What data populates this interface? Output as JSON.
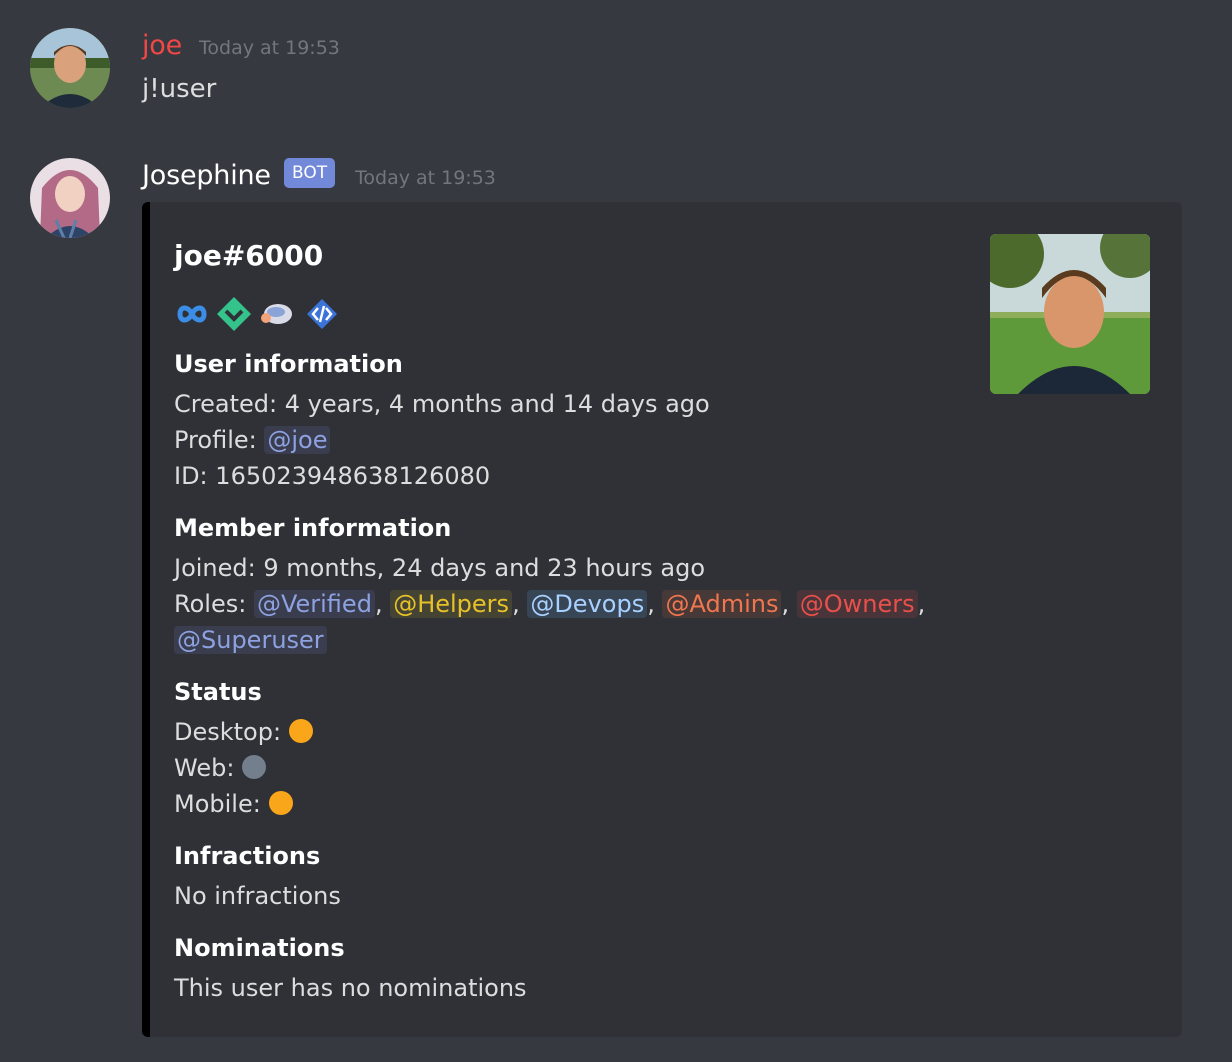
{
  "messages": {
    "first": {
      "author": "joe",
      "author_color": "#f04747",
      "timestamp": "Today at 19:53",
      "text": "j!user"
    },
    "second": {
      "author": "Josephine",
      "author_color": "#ffffff",
      "bot_tag": "BOT",
      "timestamp": "Today at 19:53"
    }
  },
  "embed": {
    "title": "joe#6000",
    "badges": [
      "hypesquad-balance-icon",
      "early-supporter-icon",
      "nitro-icon",
      "developer-badge-icon"
    ],
    "user_info": {
      "heading": "User information",
      "created_label": "Created:",
      "created_value": "4 years, 4 months and 14 days ago",
      "profile_label": "Profile:",
      "profile_mention": "@joe",
      "id_label": "ID:",
      "id_value": "165023948638126080"
    },
    "member_info": {
      "heading": "Member information",
      "joined_label": "Joined:",
      "joined_value": "9 months, 24 days and 23 hours ago",
      "roles_label": "Roles:",
      "roles": [
        "@Verified",
        "@Helpers",
        "@Devops",
        "@Admins",
        "@Owners",
        "@Superuser"
      ]
    },
    "status": {
      "heading": "Status",
      "desktop_label": "Desktop:",
      "desktop_color": "#faa61a",
      "web_label": "Web:",
      "web_color": "#747f8d",
      "mobile_label": "Mobile:",
      "mobile_color": "#faa61a"
    },
    "infractions": {
      "heading": "Infractions",
      "text": "No infractions"
    },
    "nominations": {
      "heading": "Nominations",
      "text": "This user has no nominations"
    }
  }
}
